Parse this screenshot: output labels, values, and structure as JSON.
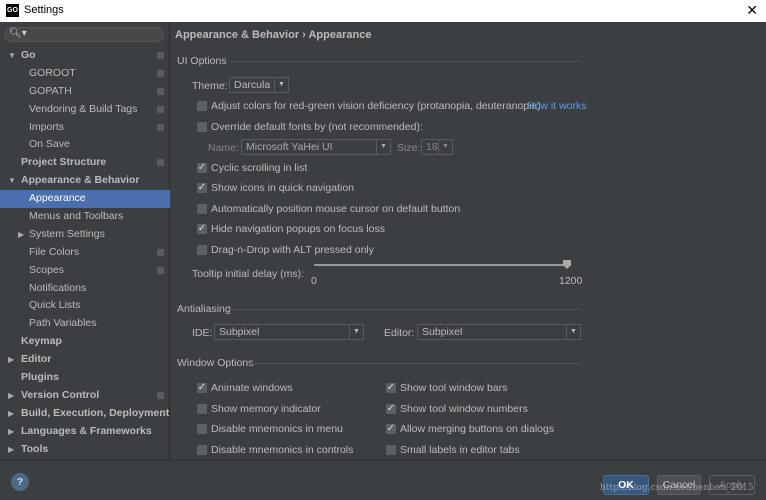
{
  "window": {
    "title": "Settings",
    "close": "✕",
    "logo": "GO"
  },
  "search": {
    "icon": "🔍︎▾"
  },
  "sidebar": {
    "items": [
      {
        "label": "Go",
        "level": 1,
        "bold": true,
        "arrow": "down",
        "icon": true
      },
      {
        "label": "GOROOT",
        "level": 2,
        "icon": true
      },
      {
        "label": "GOPATH",
        "level": 2,
        "icon": true
      },
      {
        "label": "Vendoring & Build Tags",
        "level": 2,
        "icon": true
      },
      {
        "label": "Imports",
        "level": 2,
        "icon": true
      },
      {
        "label": "On Save",
        "level": 2
      },
      {
        "label": "Project Structure",
        "level": 1,
        "bold": true,
        "icon": true
      },
      {
        "label": "Appearance & Behavior",
        "level": 1,
        "bold": true,
        "arrow": "down"
      },
      {
        "label": "Appearance",
        "level": 2,
        "selected": true
      },
      {
        "label": "Menus and Toolbars",
        "level": 2
      },
      {
        "label": "System Settings",
        "level": 2,
        "arrow": "right"
      },
      {
        "label": "File Colors",
        "level": 2,
        "icon": true
      },
      {
        "label": "Scopes",
        "level": 2,
        "icon": true
      },
      {
        "label": "Notifications",
        "level": 2
      },
      {
        "label": "Quick Lists",
        "level": 2
      },
      {
        "label": "Path Variables",
        "level": 2
      },
      {
        "label": "Keymap",
        "level": 1,
        "bold": true
      },
      {
        "label": "Editor",
        "level": 1,
        "bold": true,
        "arrow": "right"
      },
      {
        "label": "Plugins",
        "level": 1,
        "bold": true
      },
      {
        "label": "Version Control",
        "level": 1,
        "bold": true,
        "arrow": "right",
        "icon": true
      },
      {
        "label": "Build, Execution, Deployment",
        "level": 1,
        "bold": true,
        "arrow": "right"
      },
      {
        "label": "Languages & Frameworks",
        "level": 1,
        "bold": true,
        "arrow": "right"
      },
      {
        "label": "Tools",
        "level": 1,
        "bold": true,
        "arrow": "right"
      }
    ]
  },
  "breadcrumb": "Appearance & Behavior › Appearance",
  "ui_options": {
    "title": "UI Options",
    "theme_label": "Theme:",
    "theme_value": "Darcula",
    "adjust_colors": "Adjust colors for red-green vision deficiency (protanopia, deuteranopia)",
    "adjust_colors_checked": false,
    "how_it_works": "How it works",
    "override_fonts": "Override default fonts by (not recommended):",
    "override_fonts_checked": false,
    "name_label": "Name:",
    "name_value": "Microsoft YaHei UI",
    "size_label": "Size:",
    "size_value": "18",
    "cyclic": "Cyclic scrolling in list",
    "cyclic_checked": true,
    "show_icons": "Show icons in quick navigation",
    "show_icons_checked": true,
    "auto_position": "Automatically position mouse cursor on default button",
    "auto_position_checked": false,
    "hide_popups": "Hide navigation popups on focus loss",
    "hide_popups_checked": true,
    "drag_drop": "Drag-n-Drop with ALT pressed only",
    "drag_drop_checked": false,
    "tooltip_label": "Tooltip initial delay (ms):",
    "tooltip_min": "0",
    "tooltip_max": "1200",
    "tooltip_value": 1200
  },
  "antialiasing": {
    "title": "Antialiasing",
    "ide_label": "IDE:",
    "ide_value": "Subpixel",
    "editor_label": "Editor:",
    "editor_value": "Subpixel"
  },
  "window_options": {
    "title": "Window Options",
    "items": [
      {
        "label": "Animate windows",
        "checked": true
      },
      {
        "label": "Show memory indicator",
        "checked": false
      },
      {
        "label": "Disable mnemonics in menu",
        "checked": false
      },
      {
        "label": "Disable mnemonics in controls",
        "checked": false
      },
      {
        "label": "Show tool window bars",
        "checked": true
      },
      {
        "label": "Show tool window numbers",
        "checked": true
      },
      {
        "label": "Allow merging buttons on dialogs",
        "checked": true
      },
      {
        "label": "Small labels in editor tabs",
        "checked": false
      }
    ]
  },
  "footer": {
    "help": "?",
    "ok": "OK",
    "cancel": "Cancel",
    "apply": "Apply",
    "watermark": "http://blog.csdn.net/benben_2015"
  },
  "colors": {
    "selection": "#4b6eaf",
    "link": "#589df6",
    "background": "#3c3f41"
  }
}
